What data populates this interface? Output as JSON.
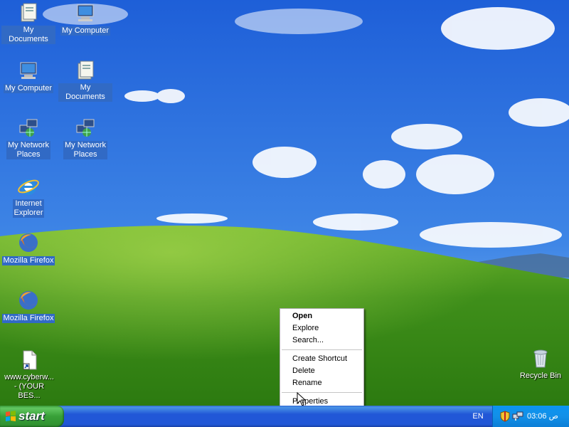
{
  "desktop": {
    "icons": [
      {
        "label": "My Documents",
        "icon": "my-documents-icon"
      },
      {
        "label": "My Computer",
        "icon": "my-computer-icon"
      },
      {
        "label": "My Computer",
        "icon": "my-computer-icon"
      },
      {
        "label": "My Documents",
        "icon": "my-documents-icon"
      },
      {
        "label": "My Network\nPlaces",
        "icon": "network-places-icon"
      },
      {
        "label": "My Network\nPlaces",
        "icon": "network-places-icon"
      },
      {
        "label": "Internet\nExplorer",
        "icon": "internet-explorer-icon"
      },
      {
        "label": "Mozilla Firefox",
        "icon": "firefox-icon"
      },
      {
        "label": "Mozilla Firefox",
        "icon": "firefox-icon"
      },
      {
        "label": "www.cyberw...\n- (YOUR BES...",
        "icon": "shortcut-file-icon"
      },
      {
        "label": "Recycle Bin",
        "icon": "recycle-bin-icon"
      }
    ]
  },
  "context_menu": {
    "items": [
      {
        "label": "Open",
        "bold": true
      },
      {
        "label": "Explore"
      },
      {
        "label": "Search..."
      },
      {
        "label": "Create Shortcut"
      },
      {
        "label": "Delete"
      },
      {
        "label": "Rename"
      },
      {
        "label": "Properties"
      }
    ]
  },
  "taskbar": {
    "start_label": "start",
    "language": "EN",
    "clock": "03:06 ص",
    "tray_icons": [
      "security-shield-icon",
      "network-icon"
    ]
  },
  "colors": {
    "taskbar_blue": "#2157d7",
    "start_green": "#38a038",
    "selection_blue": "#316ac5"
  }
}
